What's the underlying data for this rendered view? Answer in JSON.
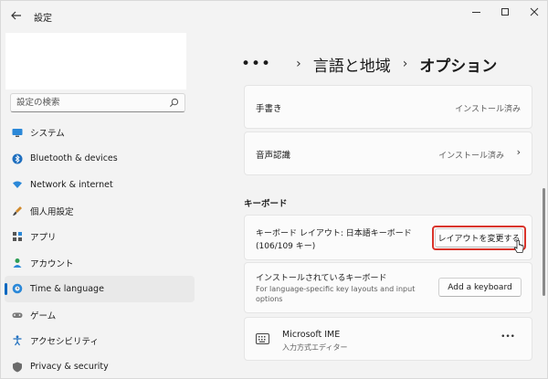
{
  "window": {
    "title": "設定"
  },
  "search": {
    "placeholder": "設定の検索"
  },
  "nav": {
    "items": [
      {
        "label": "システム",
        "icon": "monitor-icon"
      },
      {
        "label": "Bluetooth & devices",
        "icon": "bluetooth-icon"
      },
      {
        "label": "Network & internet",
        "icon": "wifi-icon"
      },
      {
        "label": "個人用設定",
        "icon": "brush-icon"
      },
      {
        "label": "アプリ",
        "icon": "apps-icon"
      },
      {
        "label": "アカウント",
        "icon": "person-icon"
      },
      {
        "label": "Time & language",
        "icon": "globe-clock-icon",
        "selected": true
      },
      {
        "label": "ゲーム",
        "icon": "gamepad-icon"
      },
      {
        "label": "アクセシビリティ",
        "icon": "accessibility-icon"
      },
      {
        "label": "Privacy & security",
        "icon": "shield-icon"
      }
    ]
  },
  "breadcrumb": {
    "more": "•••",
    "parent": "言語と地域",
    "current": "オプション"
  },
  "cards": {
    "handwriting": {
      "label": "手書き",
      "status": "インストール済み"
    },
    "speech": {
      "label": "音声認識",
      "status": "インストール済み"
    }
  },
  "keyboard_section": {
    "heading": "キーボード",
    "layout": {
      "label_line1": "キーボード レイアウト: 日本語キーボード",
      "label_line2": "(106/109 キー)",
      "button": "レイアウトを変更する"
    },
    "installed": {
      "label": "インストールされているキーボード",
      "sub_line1": "For language-specific key layouts and input",
      "sub_line2": "options",
      "button": "Add a keyboard"
    },
    "ime": {
      "name": "Microsoft IME",
      "sub": "入力方式エディター",
      "more": "•••"
    }
  },
  "colors": {
    "accent": "#0067c0",
    "highlight": "#d9342b"
  }
}
